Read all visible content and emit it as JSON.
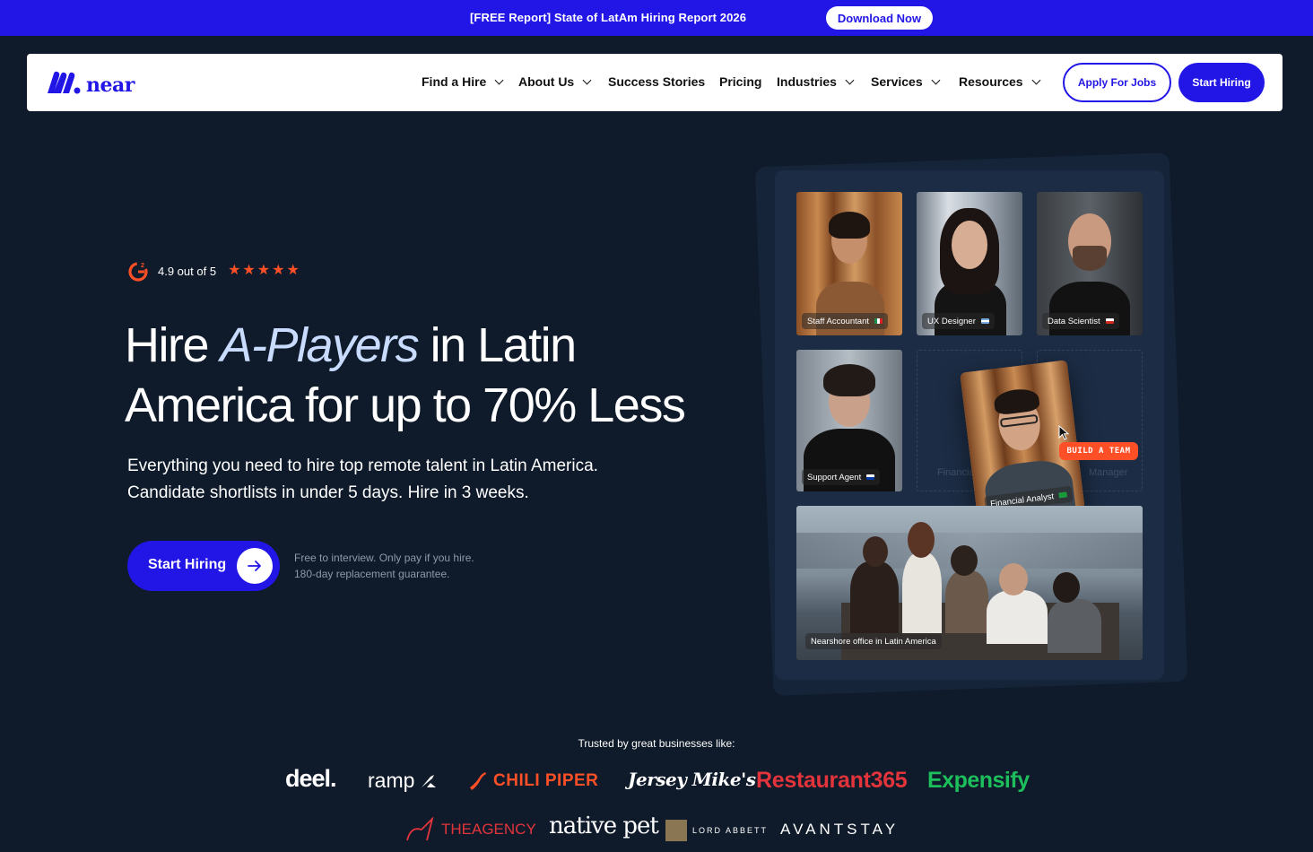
{
  "banner": {
    "text": "[FREE Report] State of LatAm Hiring Report 2026",
    "button": "Download Now"
  },
  "nav": {
    "logo": "near",
    "items": [
      {
        "label": "Find a Hire",
        "dropdown": true
      },
      {
        "label": "About Us",
        "dropdown": true
      },
      {
        "label": "Success Stories",
        "dropdown": false
      },
      {
        "label": "Pricing",
        "dropdown": false
      },
      {
        "label": "Industries",
        "dropdown": true
      },
      {
        "label": "Services",
        "dropdown": true
      },
      {
        "label": "Resources",
        "dropdown": true
      }
    ],
    "apply_button": "Apply For Jobs",
    "start_button": "Start Hiring"
  },
  "hero": {
    "rating_text": "4.9 out of 5",
    "rating_stars": 5,
    "headline_pre": "Hire ",
    "headline_accent": "A-Players",
    "headline_post": " in Latin America for up to 70% Less",
    "sub_line1": "Everything you need to hire top remote talent in Latin America.",
    "sub_line2": "Candidate shortlists in under 5 days. Hire in 3 weeks.",
    "cta": "Start Hiring",
    "fine_line1": "Free to interview. Only pay if you hire.",
    "fine_line2": "180-day replacement guarantee."
  },
  "visual": {
    "tiles": [
      {
        "label": "Staff Accountant"
      },
      {
        "label": "UX Designer"
      },
      {
        "label": "Data Scientist"
      },
      {
        "label": "Support Agent"
      }
    ],
    "dim_left": "Financia",
    "dim_right": "Manager",
    "float_label": "Financial Analyst",
    "badge": "BUILD A TEAM",
    "office_label": "Nearshore office in Latin America"
  },
  "trusted": {
    "heading": "Trusted by great businesses like:",
    "logos": [
      "deel.",
      "ramp",
      "CHILI PIPER",
      "Jersey Mike's",
      "Restaurant365",
      "Expensify",
      "THEAGENCY",
      "native pet",
      "LORD ABBETT",
      "AVANTSTAY"
    ]
  },
  "colors": {
    "brand": "#2216e6",
    "accent_orange": "#ff4f26",
    "background": "#0f1b2a",
    "expensify_green": "#1dbf5c",
    "restaurant_red": "#e3343c"
  }
}
